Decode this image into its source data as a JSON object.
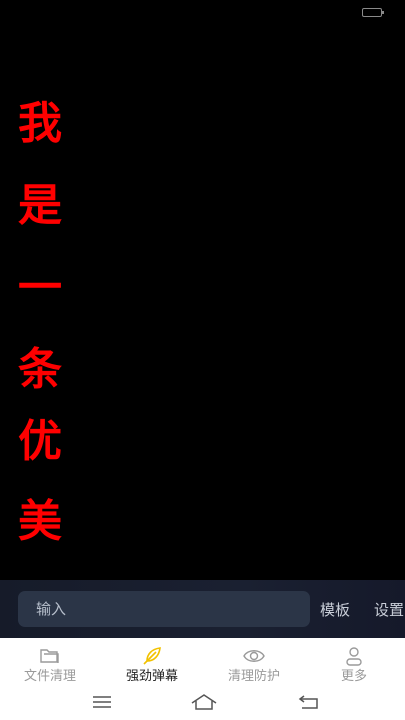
{
  "danmaku": {
    "chars": [
      "我",
      "是",
      "一",
      "条",
      "优",
      "美"
    ],
    "color": "#ff0000"
  },
  "input_panel": {
    "placeholder": "输入",
    "template_label": "模板",
    "settings_label": "设置"
  },
  "tabs": [
    {
      "label": "文件清理",
      "icon": "folder-icon"
    },
    {
      "label": "强劲弹幕",
      "icon": "feather-icon",
      "active": true
    },
    {
      "label": "清理防护",
      "icon": "eye-icon"
    },
    {
      "label": "更多",
      "icon": "person-icon"
    }
  ],
  "nav": [
    "menu-icon",
    "home-icon",
    "back-icon"
  ],
  "colors": {
    "accent": "#f2c200",
    "panel_bg": "#1a2031",
    "input_bg": "#2b3547"
  }
}
